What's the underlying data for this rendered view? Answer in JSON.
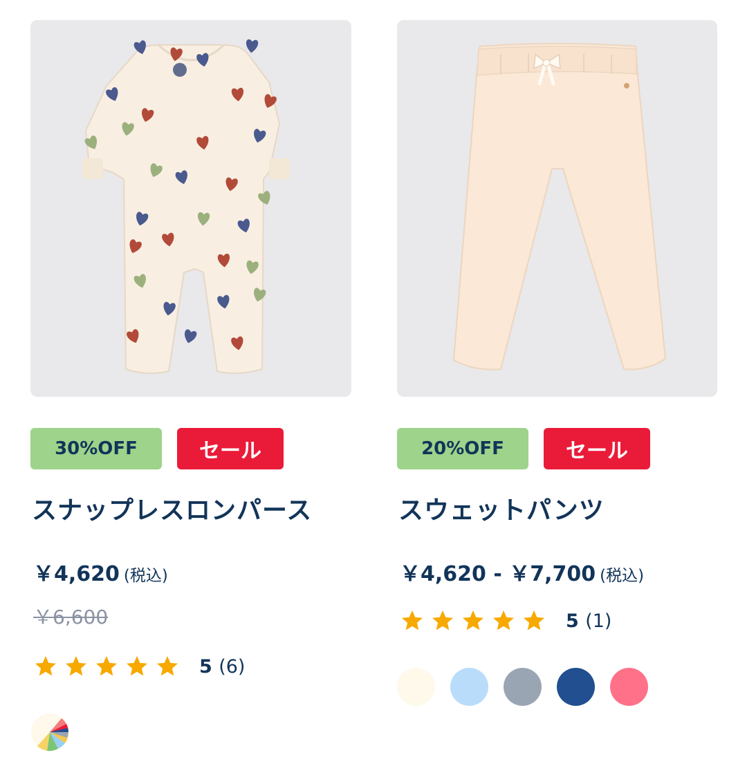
{
  "products": [
    {
      "discount_badge": "30%OFF",
      "sale_badge": "セール",
      "name": "スナップレスロンパース",
      "price": "￥4,620",
      "tax_label": "(税込)",
      "original_price": "￥6,600",
      "rating_value": "5",
      "rating_count": "(6)",
      "stars": 5,
      "image_icon": "heart-print-romper",
      "swatch_icon": "multicolor-swatch-icon",
      "heart_colors": [
        "#4a5a8e",
        "#b24a3a",
        "#9cb07e"
      ]
    },
    {
      "discount_badge": "20%OFF",
      "sale_badge": "セール",
      "name": "スウェットパンツ",
      "price": "￥4,620 - ￥7,700",
      "tax_label": "(税込)",
      "rating_value": "5",
      "rating_count": "(1)",
      "stars": 5,
      "image_icon": "sweat-pants",
      "swatch_colors": [
        "#fef9ea",
        "#b9dcfa",
        "#9aa5b4",
        "#214f8f",
        "#ff7189"
      ]
    }
  ],
  "colors": {
    "badge_off": "#9dd38a",
    "badge_sale": "#ea1b39",
    "text_navy": "#123459",
    "star": "#f7a900",
    "image_bg": "#e9e8ea"
  }
}
